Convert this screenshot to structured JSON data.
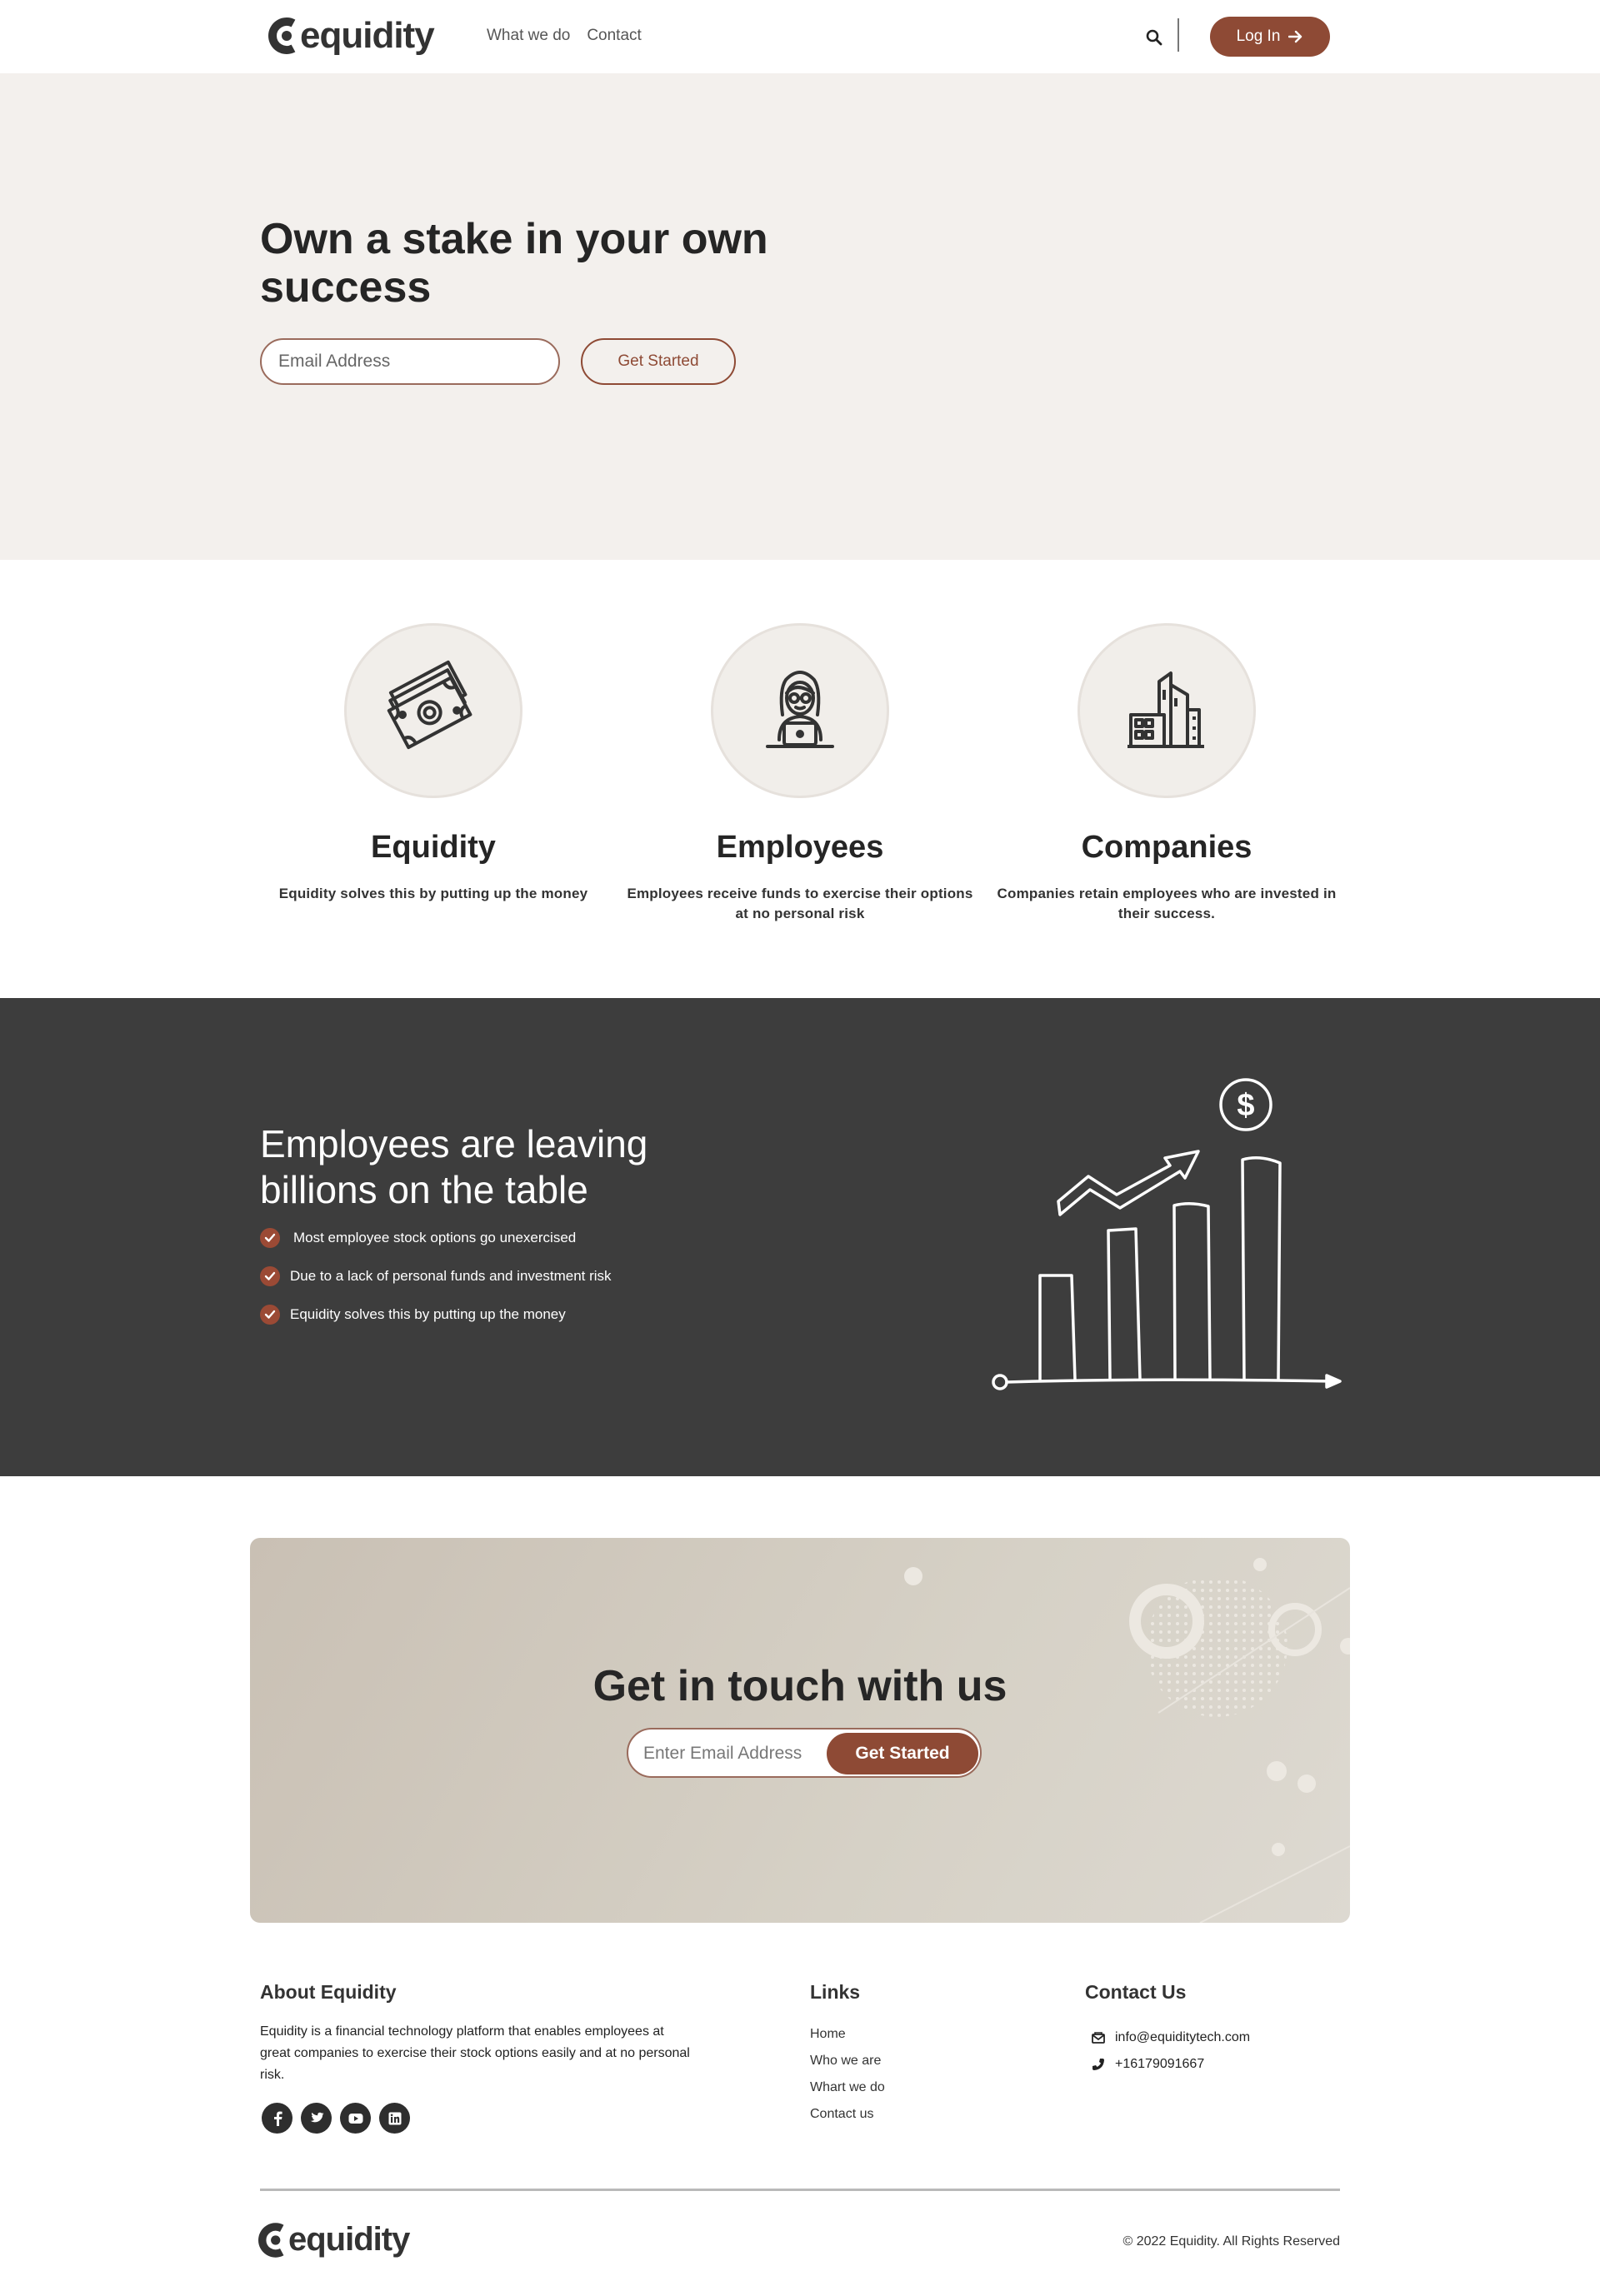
{
  "brand": {
    "name": "equidity",
    "accent": "#8e4a35"
  },
  "nav": {
    "links": [
      "What we do",
      "Contact"
    ],
    "search_icon": "search-icon",
    "login_label": "Log In"
  },
  "hero": {
    "title": "Own a stake in your own success",
    "email_placeholder": "Email Address",
    "cta_label": "Get Started"
  },
  "features": [
    {
      "icon": "money-icon",
      "title": "Equidity",
      "text": "Equidity solves this by putting up the money"
    },
    {
      "icon": "employee-laptop-icon",
      "title": "Employees",
      "text": "Employees receive funds to exercise their options at no personal risk"
    },
    {
      "icon": "buildings-icon",
      "title": "Companies",
      "text": "Companies retain employees who are invested in their success."
    }
  ],
  "problem": {
    "title": "Employees are leaving billions on the table",
    "bullets": [
      "Most employee stock options go unexercised",
      "Due to a lack of personal funds and investment risk",
      "Equidity solves this by putting up the money"
    ],
    "illustration": "growth-chart-icon",
    "dollar_symbol": "$"
  },
  "contact_cta": {
    "title": "Get in touch with us",
    "email_placeholder": "Enter Email Address",
    "button_label": "Get Started"
  },
  "footer": {
    "about_title": "About Equidity",
    "about_text": "Equidity is a financial technology platform that enables employees at great companies to exercise their stock options easily and at no personal risk.",
    "socials": [
      "facebook-icon",
      "twitter-icon",
      "youtube-icon",
      "linkedin-icon"
    ],
    "links_title": "Links",
    "links": [
      "Home",
      "Who we are",
      "Whart we do",
      "Contact us"
    ],
    "contact_title": "Contact Us",
    "email": "info@equiditytech.com",
    "phone": "+16179091667",
    "copyright": "© 2022 Equidity. All Rights Reserved"
  }
}
